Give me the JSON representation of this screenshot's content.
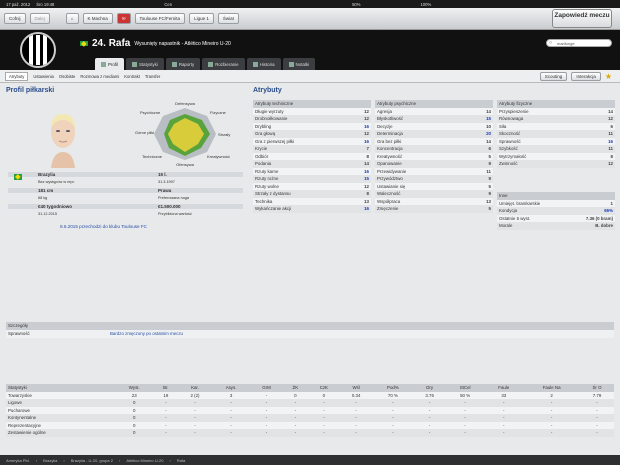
{
  "os_bar": {
    "date": "17 paź. 2012",
    "day": "Śro 19:48",
    "net": "Cen",
    "vol": "50%",
    "battery": "100%"
  },
  "topbar": {
    "back": "Cofnij",
    "forward": "Dalej",
    "home": "⌂",
    "club": "K Machna",
    "inbox": "✉",
    "team": "Toulouse FC/Fernita",
    "league": "Ligue 1",
    "world": "Świat",
    "continue_label": "Zapowiedź meczu"
  },
  "player": {
    "number": "24.",
    "name": "Rafa",
    "position": "Wysunięty napastnik - Atlético Mineiro U-20"
  },
  "tabs": [
    "Profil",
    "Statystyki",
    "Raporty",
    "Rozbieranie",
    "Historia",
    "Notatki"
  ],
  "search": {
    "placeholder": "marilunge"
  },
  "subnav": [
    "Atrybuty",
    "Ustawienia",
    "Osobiste",
    "Rozmowa z mediami",
    "Kontrakt",
    "Transfer"
  ],
  "subbtns": {
    "scouting": "Scouting",
    "interact": "Interakcja"
  },
  "profile": {
    "title": "Profil piłkarski",
    "radar_labels": [
      "Defensywa",
      "Fizyczne",
      "Strzały",
      "Kreatywność",
      "Ofensywa",
      "Techniczne",
      "Górne piłki",
      "Psychiczne"
    ],
    "rows": [
      {
        "l1": "Brazylia",
        "l2": "15 l."
      },
      {
        "l1": "Bez występów w repr.",
        "l2": "31.3.1997"
      },
      {
        "l1": "181 cm",
        "l2": "Prawa"
      },
      {
        "l1": "68 kg",
        "l2": "Preferowana noga"
      },
      {
        "l1": "€40 tygodniowo",
        "l2": "€1.500.000"
      },
      {
        "l1": "31.12.2015",
        "l2": "Przybliżona wartość"
      }
    ],
    "transfer": "9.6.2015 przechodzi do klubu Toulouse FC"
  },
  "attributes_title": "Atrybuty",
  "technical": {
    "header": "Atrybuty techniczne",
    "items": [
      [
        "Długie wyrzuty",
        "12"
      ],
      [
        "Drobnoiłkowanie",
        "12"
      ],
      [
        "Drybling",
        "16"
      ],
      [
        "Gra głową",
        "12"
      ],
      [
        "Gra z pierwszej piłki",
        "16"
      ],
      [
        "Krycie",
        "7"
      ],
      [
        "Odbiór",
        "8"
      ],
      [
        "Podania",
        "14"
      ],
      [
        "Rzuty karne",
        "16"
      ],
      [
        "Rzuty rożne",
        "15"
      ],
      [
        "Rzuty wolne",
        "12"
      ],
      [
        "Strzały z dystansu",
        "8"
      ],
      [
        "Technika",
        "13"
      ],
      [
        "Wykańczanie akcji",
        "16"
      ]
    ]
  },
  "mental": {
    "header": "Atrybuty psychiczne",
    "items": [
      [
        "Agresja",
        "14"
      ],
      [
        "Błyskotliwość",
        "15"
      ],
      [
        "Decyzje",
        "10"
      ],
      [
        "Determinacja",
        "20"
      ],
      [
        "Gra bez piłki",
        "14"
      ],
      [
        "Koncentracja",
        "6"
      ],
      [
        "Kreatywność",
        "5"
      ],
      [
        "Opanowanie",
        "9"
      ],
      [
        "Przewidywanie",
        "11"
      ],
      [
        "Przywództwo",
        "9"
      ],
      [
        "Ustawianie się",
        "5"
      ],
      [
        "Waleczność",
        "9"
      ],
      [
        "Współpraca",
        "13"
      ],
      [
        "Zmęczenie",
        "5"
      ]
    ]
  },
  "physical": {
    "header": "Atrybuty fizyczne",
    "items": [
      [
        "Przyspieszenie",
        "14"
      ],
      [
        "Równowaga",
        "12"
      ],
      [
        "Siła",
        "6"
      ],
      [
        "Skoczność",
        "11"
      ],
      [
        "Sprawność",
        "16"
      ],
      [
        "Szybkość",
        "11"
      ],
      [
        "Wytrzymałość",
        "8"
      ],
      [
        "Zwinność",
        "12"
      ]
    ]
  },
  "misc": {
    "header": "Inne",
    "items": [
      [
        "Umiejęt. bramkarskie",
        "1"
      ],
      [
        "Kondycja",
        "65%"
      ],
      [
        "Ostatnie 5 wyst.",
        "7.36 (0 bram)"
      ],
      [
        "Morale",
        "B. dobre"
      ]
    ]
  },
  "details": {
    "header": "Szczegóły",
    "label": "Sprawność",
    "value": "Bardzo zmęczony po ostatnim meczu"
  },
  "stats": {
    "columns": [
      "Statystyki",
      "Wyst.",
      "Br.",
      "Kar.",
      "Asys.",
      "GrM",
      "ŻK",
      "CzK",
      "Wśl",
      "Pod%",
      "Dry",
      "StCel",
      "Faule",
      "Faule Na",
      "Śr O"
    ],
    "rows": [
      [
        "Towarzyskie",
        "23",
        "19",
        "2 (2)",
        "3",
        "-",
        "0",
        "0",
        "0.34",
        "70 %",
        "3.76",
        "50 %",
        "33",
        "2",
        "7.79"
      ],
      [
        "Ligowe",
        "0",
        "-",
        "-",
        "-",
        "-",
        "-",
        "-",
        "-",
        "-",
        "-",
        "-",
        "-",
        "-",
        "-"
      ],
      [
        "Pucharowe",
        "0",
        "-",
        "-",
        "-",
        "-",
        "-",
        "-",
        "-",
        "-",
        "-",
        "-",
        "-",
        "-",
        "-"
      ],
      [
        "Kontynentalne",
        "0",
        "-",
        "-",
        "-",
        "-",
        "-",
        "-",
        "-",
        "-",
        "-",
        "-",
        "-",
        "-",
        "-"
      ],
      [
        "Reprezentacyjne",
        "0",
        "-",
        "-",
        "-",
        "-",
        "-",
        "-",
        "-",
        "-",
        "-",
        "-",
        "-",
        "-",
        "-"
      ],
      [
        "Zestawienie ogólne",
        "0",
        "-",
        "-",
        "-",
        "-",
        "-",
        "-",
        "-",
        "-",
        "-",
        "-",
        "-",
        "-",
        "-"
      ]
    ]
  },
  "breadcrumbs": [
    "Ameryka Płd.",
    "Brazylia",
    "Brazylia - U-20, grupa 2",
    "Atlético Mineiro U-20",
    "Rafa"
  ]
}
